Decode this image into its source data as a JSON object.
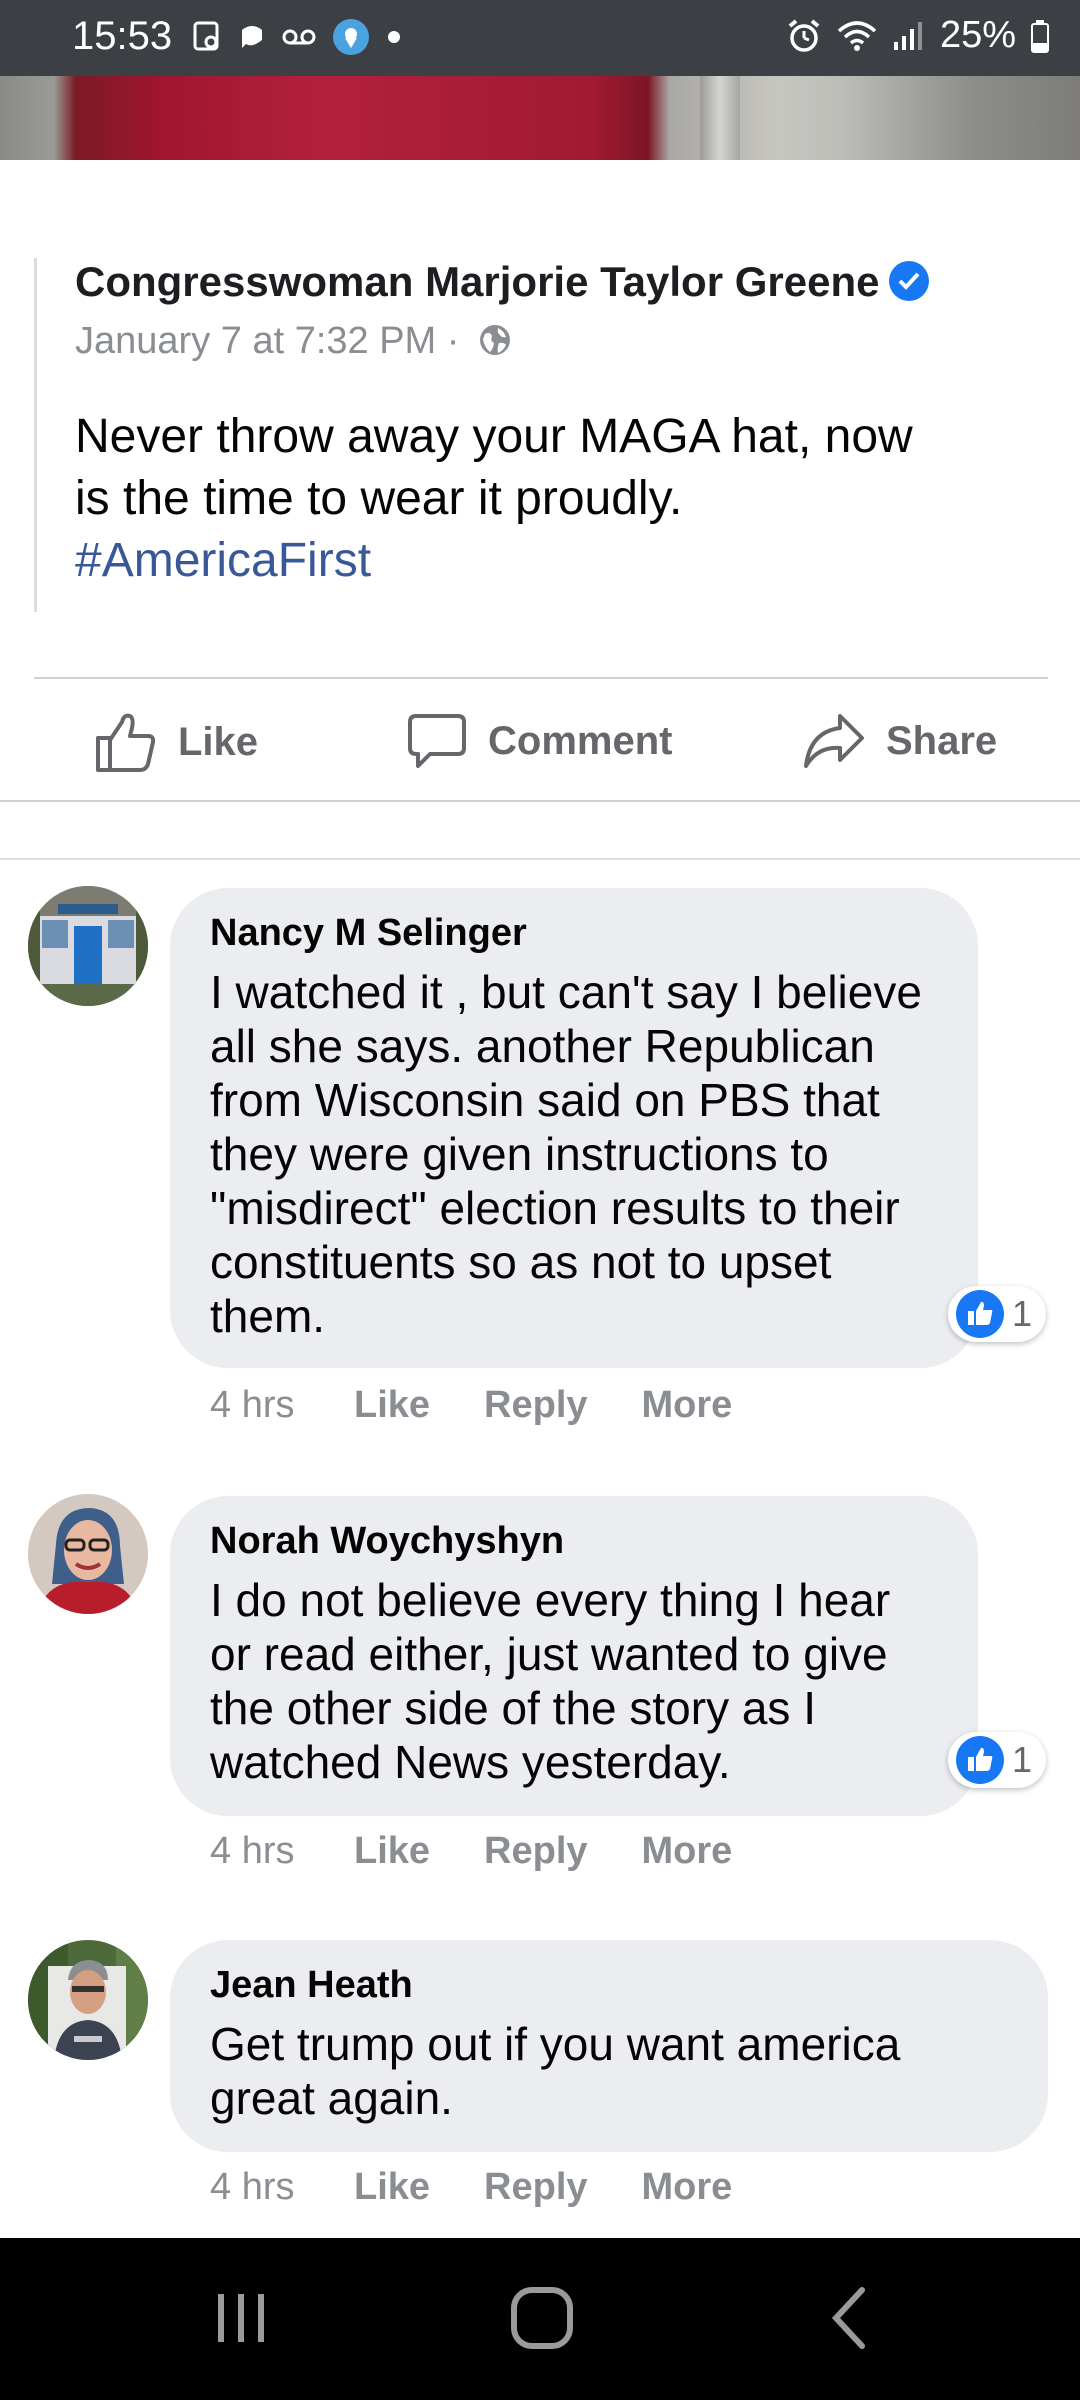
{
  "status_bar": {
    "time": "15:53",
    "battery": "25%"
  },
  "post": {
    "author": "Congresswoman Marjorie Taylor Greene",
    "timestamp": "January 7 at 7:32 PM ·",
    "text_lines": [
      "Never throw away your MAGA hat, now",
      "is the time to wear it proudly."
    ],
    "hashtag": "#AmericaFirst"
  },
  "actions": {
    "like": "Like",
    "comment": "Comment",
    "share": "Share"
  },
  "comments": [
    {
      "name": "Nancy M Selinger",
      "text": "I watched it , but can't say I believe all she says. another Republican from Wisconsin said on PBS that they were given instructions to \"misdirect\" election results to their constituents so as not to upset them.",
      "reaction_count": "1",
      "time": "4 hrs",
      "like": "Like",
      "reply": "Reply",
      "more": "More"
    },
    {
      "name": "Norah Woychyshyn",
      "text": "I do not believe every thing I hear or read either, just wanted to give the other side of the story as I watched News yesterday.",
      "reaction_count": "1",
      "time": "4 hrs",
      "like": "Like",
      "reply": "Reply",
      "more": "More"
    },
    {
      "name": "Jean Heath",
      "text": "Get trump out if you want america great again.",
      "time": "4 hrs",
      "like": "Like",
      "reply": "Reply",
      "more": "More"
    }
  ],
  "colors": {
    "accent_blue": "#1877f2",
    "hashtag": "#385898",
    "bubble": "#ebedf0",
    "status_bar": "#3c4045",
    "nav_bar": "#000000"
  },
  "icons": [
    "gallery-icon",
    "message-icon",
    "voicemail-icon",
    "location-icon",
    "dot-icon",
    "alarm-icon",
    "wifi-icon",
    "signal-icon",
    "battery-icon",
    "verified-icon",
    "globe-icon",
    "thumbs-up-icon",
    "comment-icon",
    "share-icon",
    "recent-apps-icon",
    "home-icon",
    "back-icon"
  ]
}
